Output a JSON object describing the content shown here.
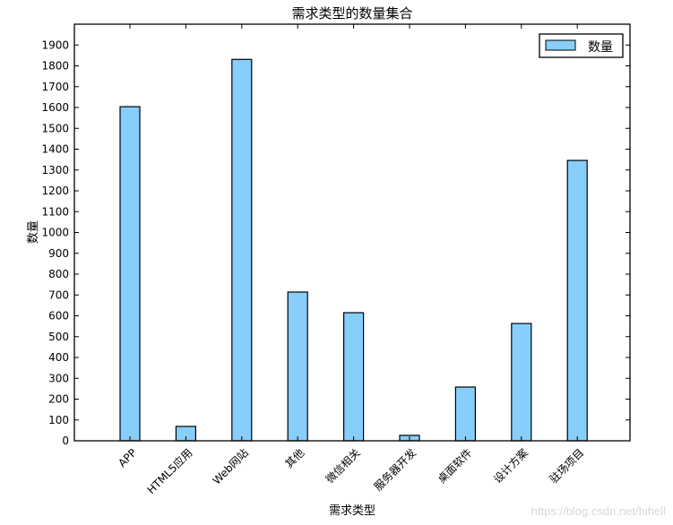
{
  "chart_data": {
    "type": "bar",
    "title": "需求类型的数量集合",
    "xlabel": "需求类型",
    "ylabel": "数量",
    "categories": [
      "APP",
      "HTML5应用",
      "Web网站",
      "其他",
      "微信相关",
      "服务器开发",
      "桌面软件",
      "设计方案",
      "驻场项目"
    ],
    "series": [
      {
        "name": "数量",
        "values": [
          1604,
          69,
          1831,
          714,
          615,
          26,
          258,
          563,
          1346
        ],
        "color": "#87CEFA"
      }
    ],
    "ylim": [
      0,
      2000
    ],
    "yticks": [
      0,
      100,
      200,
      300,
      400,
      500,
      600,
      700,
      800,
      900,
      1000,
      1100,
      1200,
      1300,
      1400,
      1500,
      1600,
      1700,
      1800,
      1900
    ],
    "xtick_rotation": 45,
    "grid": false,
    "legend": {
      "position": "top-right",
      "entries": [
        "数量"
      ]
    }
  },
  "watermark": "https://blog.csdn.net/hihell"
}
